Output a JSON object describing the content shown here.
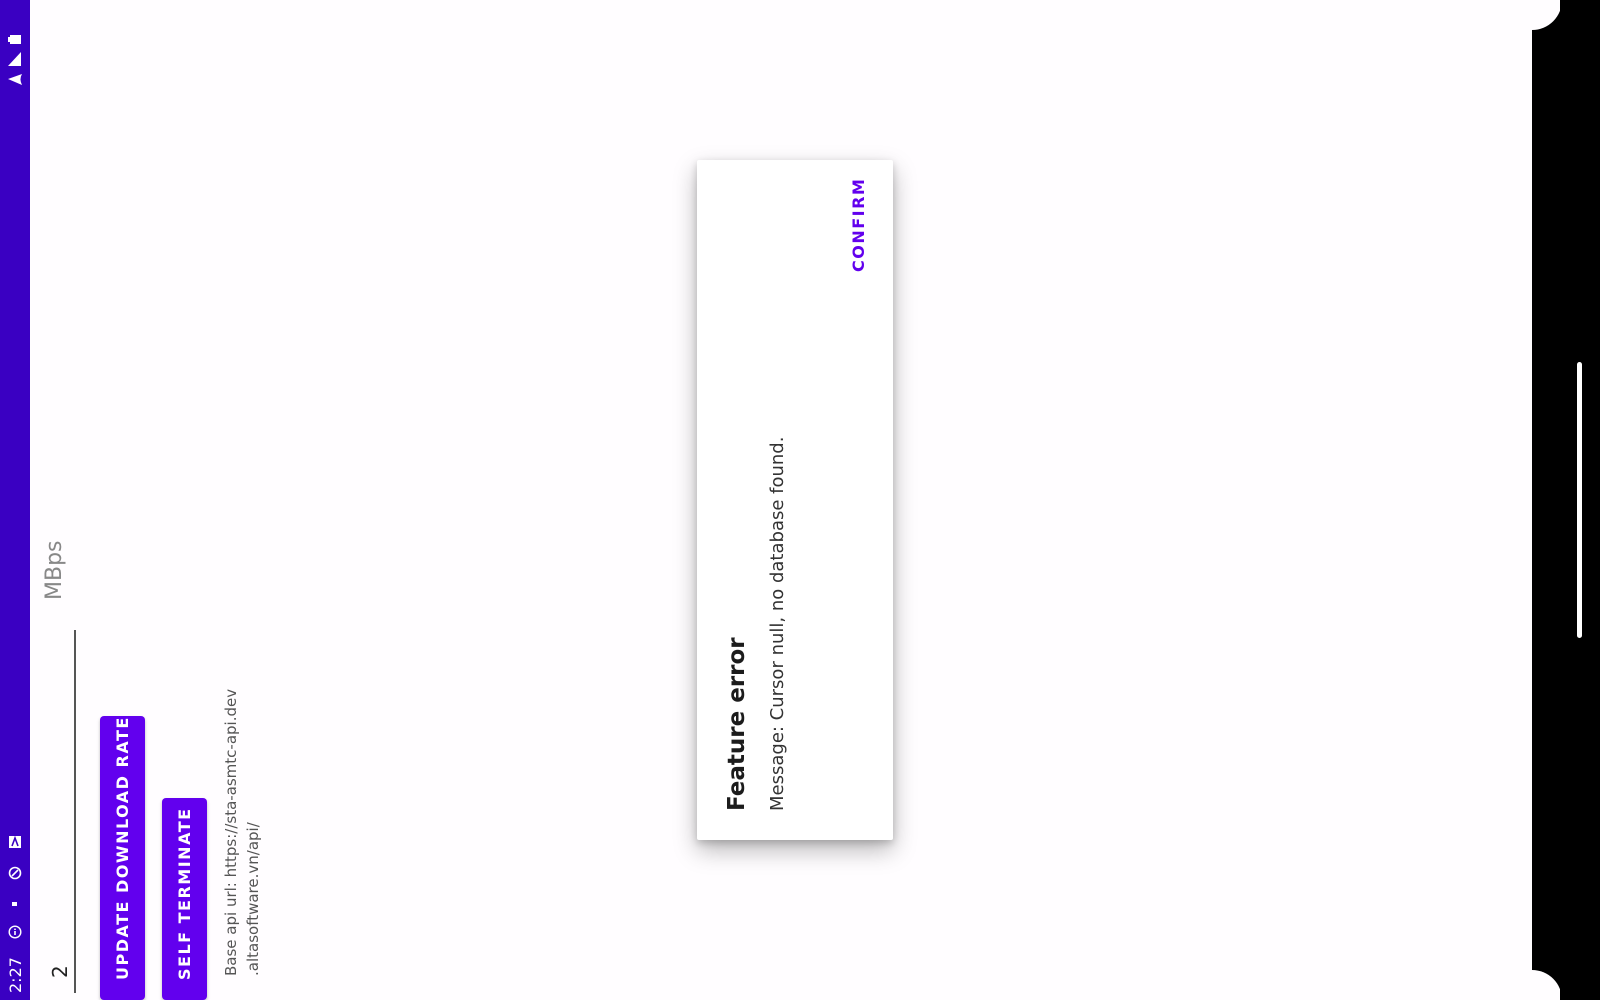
{
  "status_bar": {
    "time": "2:27",
    "icons": [
      "battery-icon",
      "signal-icon",
      "wifi-icon",
      "notification-a-icon",
      "vpn-icon",
      "dot-icon",
      "info-icon"
    ]
  },
  "download_rate": {
    "value": "2",
    "unit": "MBps"
  },
  "buttons": {
    "update_label": "UPDATE DOWNLOAD RATE",
    "terminate_label": "SELF TERMINATE"
  },
  "api": {
    "line1": "Base api url: https://sta-asmtc-api.dev",
    "line2": ".altasoftware.vn/api/"
  },
  "dialog": {
    "title": "Feature error",
    "message": "Message: Cursor null, no database found.",
    "confirm_label": "CONFIRM"
  },
  "colors": {
    "status_bar": "#3a00c2",
    "primary": "#6200ee"
  }
}
